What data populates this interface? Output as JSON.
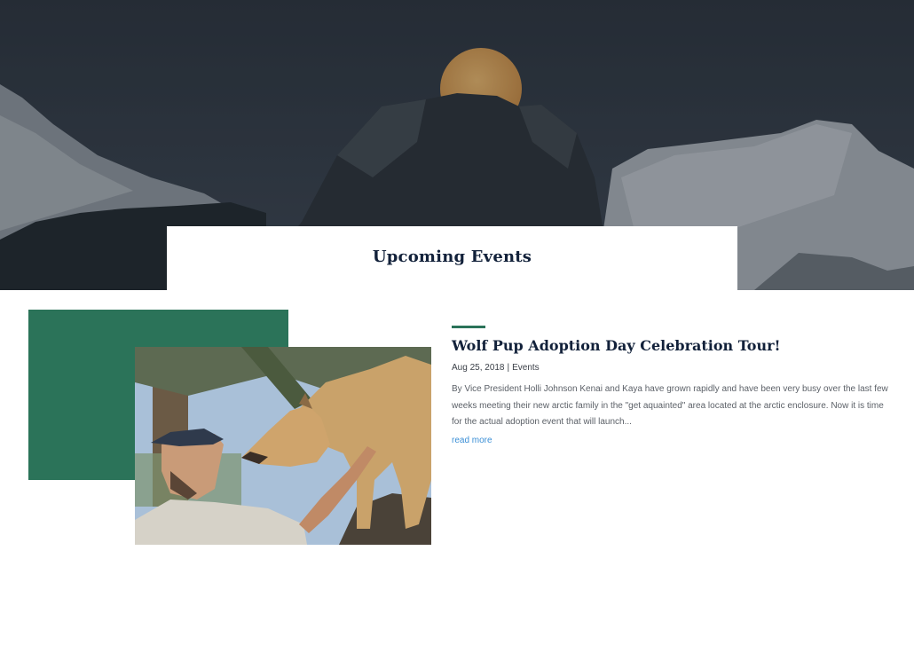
{
  "section": {
    "title": "Upcoming Events"
  },
  "post": {
    "title": "Wolf Pup Adoption Day Celebration Tour!",
    "date": "Aug 25, 2018",
    "separator": "|",
    "category": "Events",
    "excerpt": "By Vice President Holli Johnson Kenai and Kaya have grown rapidly and have been very busy over the last few weeks meeting their new arctic family in the \"get aquainted\" area located at the arctic enclosure. Now it is time for the actual adoption event that will launch...",
    "read_more": "read more"
  },
  "colors": {
    "accent_green": "#2b7359",
    "title_navy": "#12213a",
    "link_blue": "#3b8fd6"
  }
}
